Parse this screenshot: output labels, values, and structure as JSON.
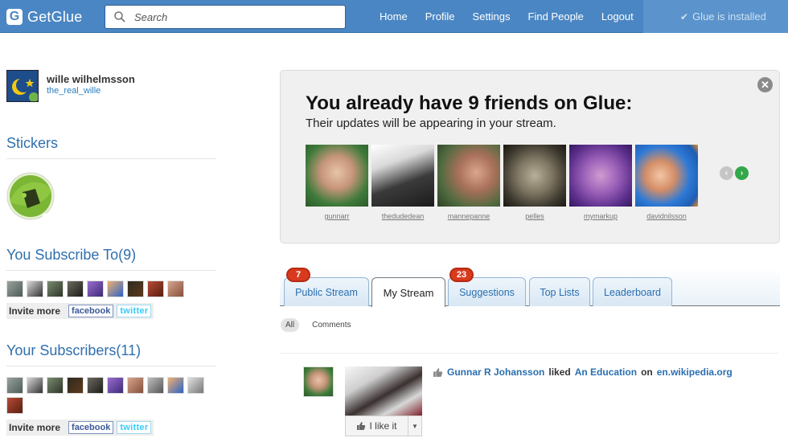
{
  "brand": {
    "name": "GetGlue",
    "logo_letter": "G"
  },
  "search": {
    "placeholder": "Search"
  },
  "nav": {
    "items": [
      "Home",
      "Profile",
      "Settings",
      "Find People",
      "Logout"
    ]
  },
  "status": {
    "installed_text": "Glue is installed"
  },
  "profile": {
    "name": "wille wilhelmsson",
    "handle": "the_real_wille"
  },
  "stickers": {
    "title": "Stickers"
  },
  "subscriptions": {
    "title": "You Subscribe To(9)",
    "invite_label": "Invite more",
    "facebook": "facebook",
    "twitter": "twitter"
  },
  "subscribers": {
    "title": "Your Subscribers(11)",
    "invite_label": "Invite more",
    "facebook": "facebook",
    "twitter": "twitter"
  },
  "friends_box": {
    "title": "You already have 9 friends on Glue:",
    "subtitle": "Their updates will be appearing in your stream.",
    "friends": [
      "gunnarr",
      "thedudedean",
      "mannepanne",
      "pelles",
      "mymarkup",
      "davidnilsson"
    ],
    "close_icon": "close-icon"
  },
  "tabs": {
    "items": [
      {
        "label": "Public Stream",
        "badge": "7"
      },
      {
        "label": "My Stream",
        "badge": ""
      },
      {
        "label": "Suggestions",
        "badge": "23"
      },
      {
        "label": "Top Lists",
        "badge": ""
      },
      {
        "label": "Leaderboard",
        "badge": ""
      }
    ],
    "active": "My Stream"
  },
  "filters": {
    "all": "All",
    "comments": "Comments"
  },
  "stream_item": {
    "user": "Gunnar R Johansson",
    "verb": "liked",
    "object": "An Education",
    "preposition": "on",
    "source": "en.wikipedia.org",
    "like_label": "I like it"
  },
  "colors": {
    "header": "#4a86c3",
    "link": "#2a6fb0",
    "badge": "#d93a1e",
    "next_arrow": "#33a84a"
  }
}
